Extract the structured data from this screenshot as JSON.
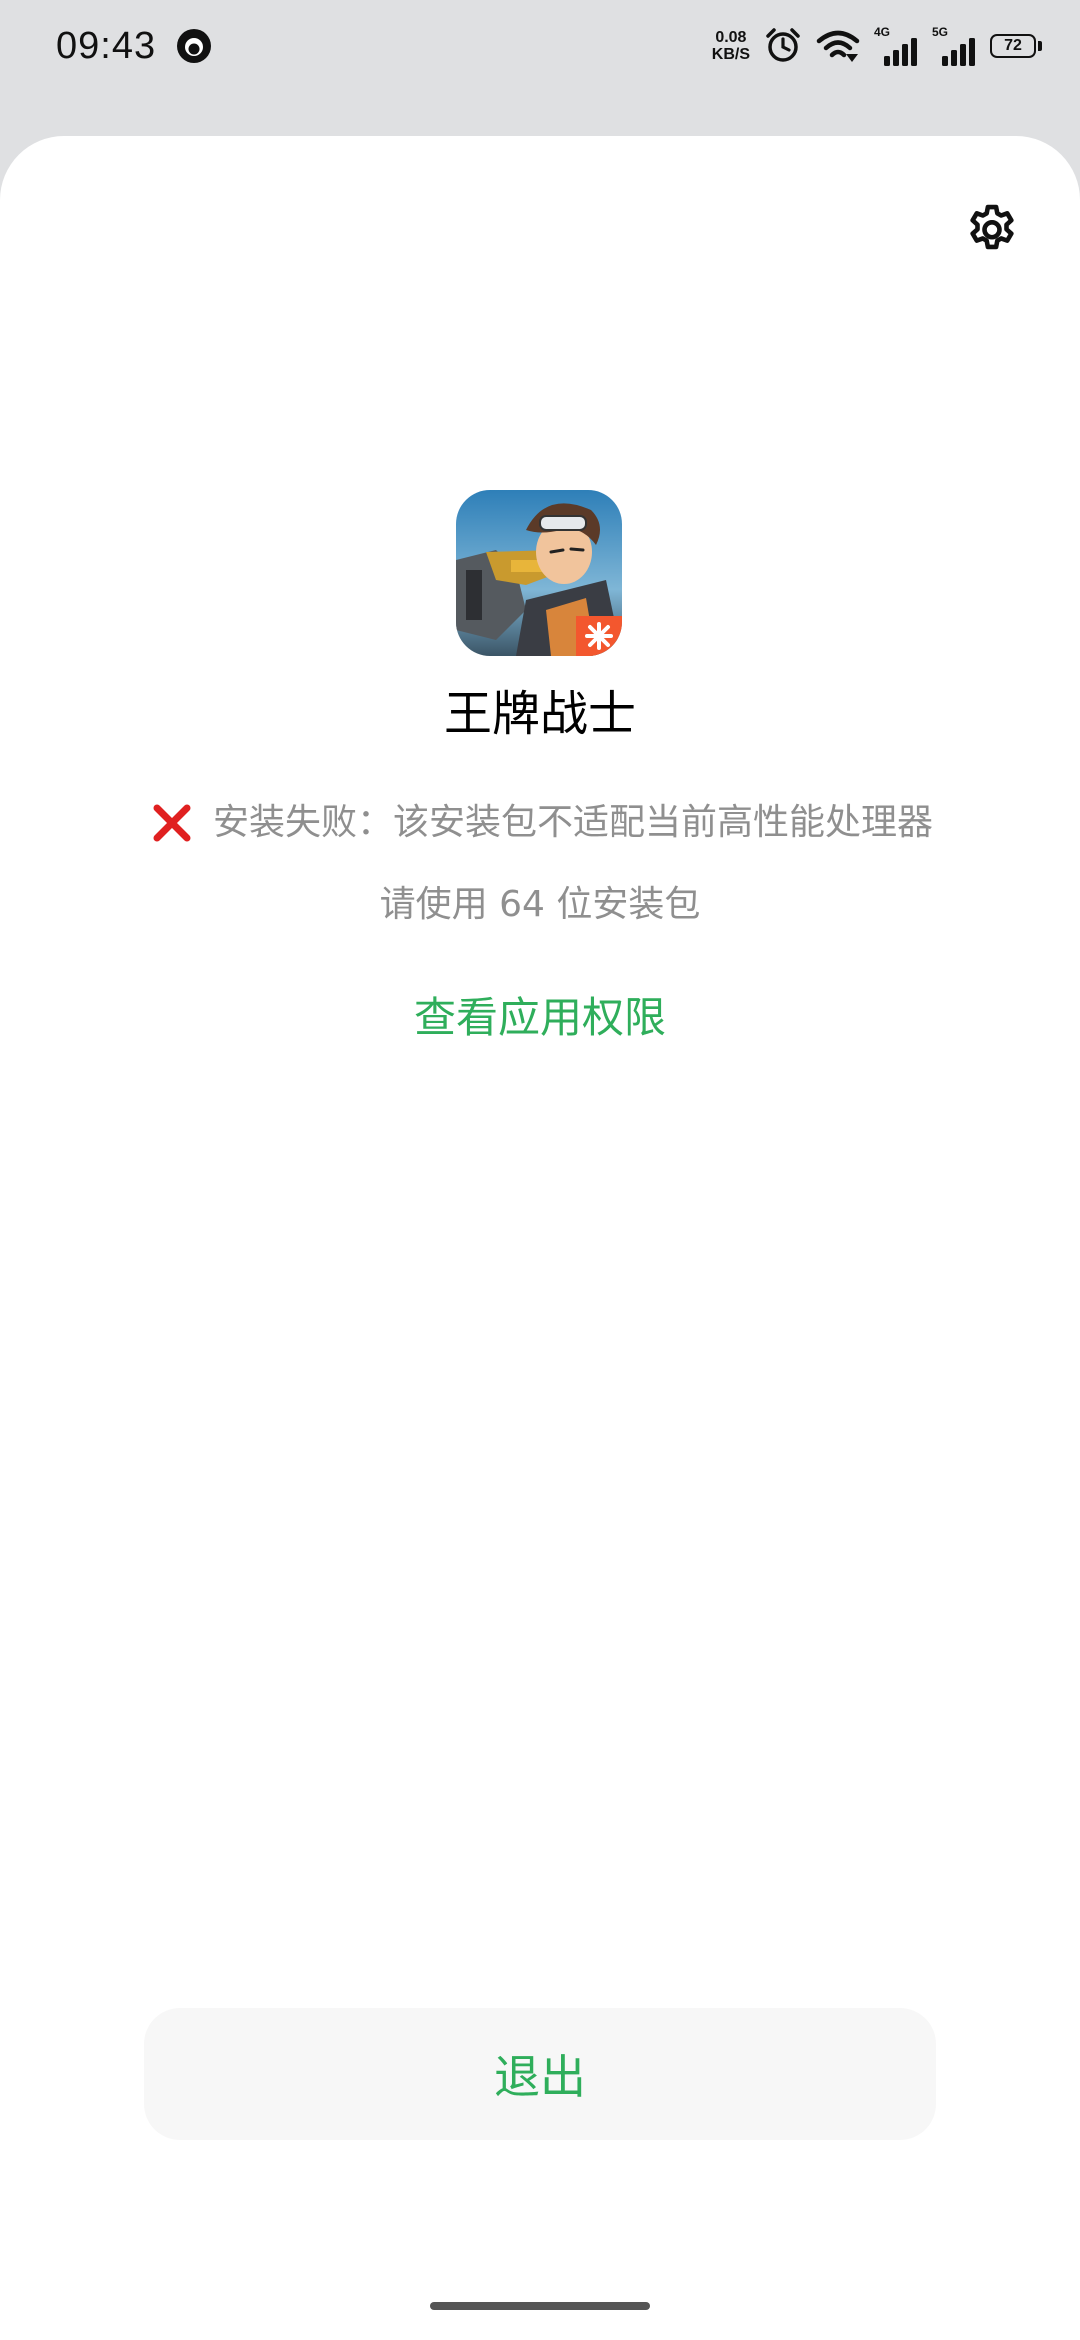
{
  "status_bar": {
    "time": "09:43",
    "net_speed_value": "0.08",
    "net_speed_unit": "KB/S",
    "network_1": "4G",
    "network_2": "5G",
    "battery_level": "72",
    "icons": [
      "app-notification-icon",
      "alarm-icon",
      "wifi-icon",
      "signal-icon",
      "signal-icon",
      "battery-icon"
    ]
  },
  "header": {
    "settings_icon": "gear-icon"
  },
  "app": {
    "name": "王牌战士",
    "icon": "app-icon-game-character"
  },
  "install_result": {
    "status_icon": "red-x-icon",
    "status_color": "#e02020",
    "error_message": "安装失败：该安装包不适配当前高性能处理器",
    "hint": "请使用 64 位安装包"
  },
  "actions": {
    "view_permissions_label": "查看应用权限",
    "exit_label": "退出",
    "accent_color": "#2fae5b"
  }
}
